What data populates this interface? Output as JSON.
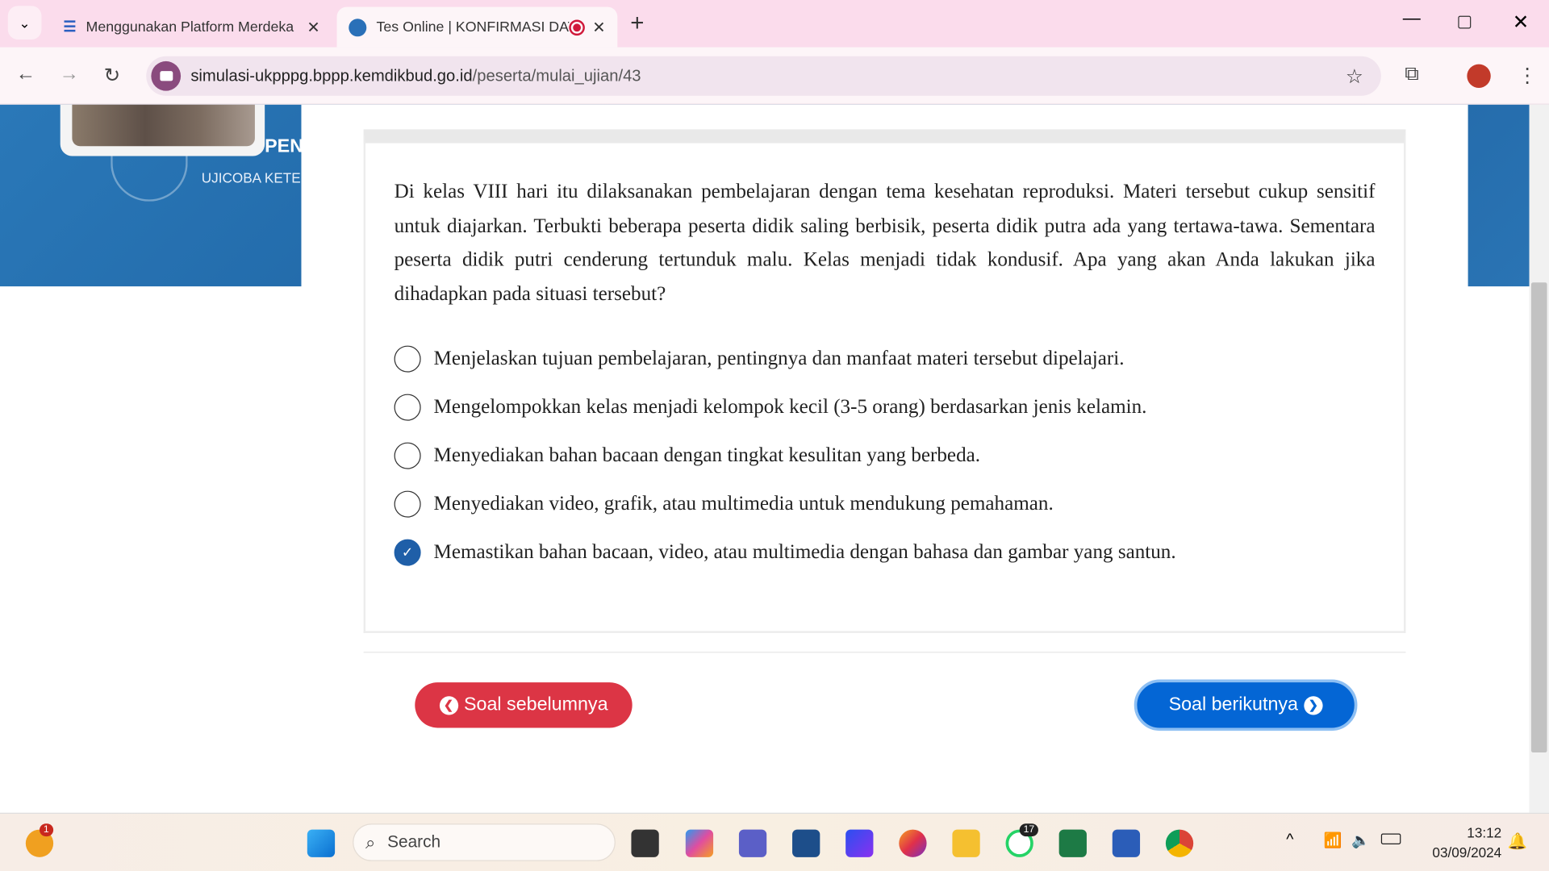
{
  "browser": {
    "tabs": [
      {
        "title": "Menggunakan Platform Merdeka",
        "active": false
      },
      {
        "title": "Tes Online | KONFIRMASI DATA",
        "active": true
      }
    ],
    "url_domain": "simulasi-ukpppg.bppp.kemdikbud.go.id",
    "url_path": "/peserta/mulai_ujian/43"
  },
  "header": {
    "title_fragment": "PEN",
    "subtitle_fragment": "UJICOBA KETE"
  },
  "question": {
    "text": "Di kelas VIII hari itu dilaksanakan pembelajaran dengan tema kesehatan reproduksi. Materi tersebut cukup sensitif untuk diajarkan. Terbukti beberapa peserta didik saling berbisik, peserta didik putra ada yang tertawa-tawa. Sementara peserta didik putri cenderung tertunduk malu. Kelas menjadi tidak kondusif. Apa yang akan Anda lakukan jika dihadapkan pada situasi tersebut?",
    "options": [
      {
        "label": "Menjelaskan tujuan pembelajaran, pentingnya dan manfaat materi tersebut dipelajari.",
        "selected": false
      },
      {
        "label": "Mengelompokkan kelas menjadi kelompok kecil (3-5 orang) berdasarkan jenis kelamin.",
        "selected": false
      },
      {
        "label": "Menyediakan bahan bacaan dengan tingkat kesulitan yang berbeda.",
        "selected": false
      },
      {
        "label": "Menyediakan video, grafik, atau multimedia untuk mendukung pemahaman.",
        "selected": false
      },
      {
        "label": "Memastikan bahan bacaan, video, atau multimedia dengan bahasa dan gambar yang santun.",
        "selected": true
      }
    ]
  },
  "nav": {
    "prev_label": "Soal sebelumnya",
    "next_label": "Soal berikutnya",
    "prev_color": "#dc3545",
    "next_color": "#0466d5"
  },
  "taskbar": {
    "search_placeholder": "Search",
    "weather_badge": "1",
    "whatsapp_badge": "17",
    "time": "13:12",
    "date": "03/09/2024"
  }
}
